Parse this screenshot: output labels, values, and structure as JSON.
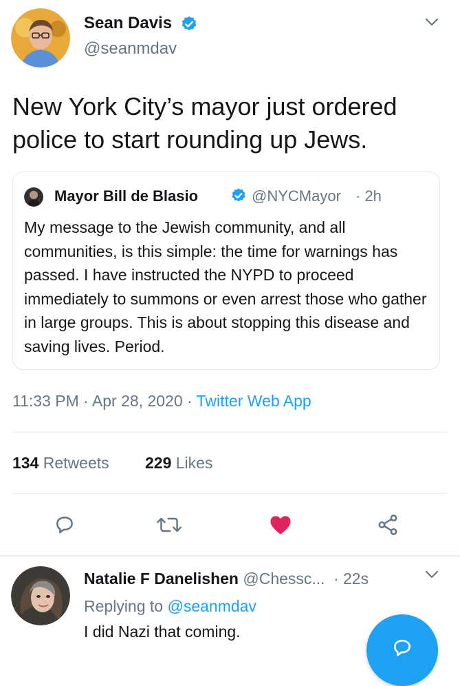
{
  "tweet": {
    "author": {
      "name": "Sean Davis",
      "handle": "@seanmdav",
      "verified": true
    },
    "text": "New York City’s mayor just ordered police to start rounding up Jews.",
    "quoted": {
      "author_name": "Mayor Bill de Blasio",
      "handle": "@NYCMayor",
      "time": "· 2h",
      "text": "My message to the Jewish community, and all communities, is this simple: the time for warnings has passed. I have instructed the NYPD to proceed immediately to summons or even arrest those who gather in large groups. This is about stopping this disease and saving lives. Period."
    },
    "timestamp": "11:33 PM · Apr 28, 2020 ·",
    "source": "Twitter Web App",
    "retweets_count": "134",
    "retweets_label": "Retweets",
    "likes_count": "229",
    "likes_label": "Likes"
  },
  "reply": {
    "author_name": "Natalie F Danelishen",
    "handle": "@Chessc...",
    "time": "· 22s",
    "replying_prefix": "Replying to",
    "replying_to": "@seanmdav",
    "text": "I did Nazi that coming."
  },
  "colors": {
    "accent": "#1da1f2",
    "like_red": "#e0245e",
    "muted": "#657786",
    "text": "#14171a",
    "border": "#e1e8ed"
  },
  "icons": [
    "chevron-down-icon",
    "verified-badge-icon",
    "reply-icon",
    "retweet-icon",
    "heart-icon",
    "share-icon",
    "compose-icon"
  ]
}
